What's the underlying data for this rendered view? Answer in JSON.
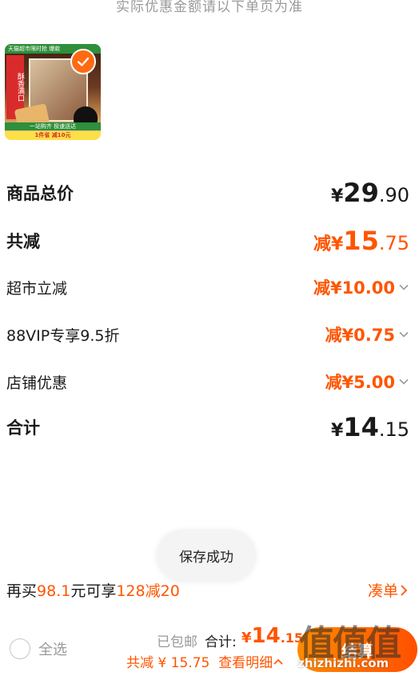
{
  "header": {
    "note": "实际优惠金额请以下单页为准"
  },
  "product": {
    "image_alt": "product-thumbnail",
    "image_top_text": "天猫超市限时抢 爆款",
    "image_side_text": "酥香满口",
    "image_band_text": "一站购齐 极速送达",
    "image_band2_text": "1件省 减10元"
  },
  "summary": {
    "total_price": {
      "label": "商品总价",
      "yen": "¥",
      "int": "29",
      "dec": ".90"
    },
    "total_discount": {
      "label": "共减",
      "prefix": "减",
      "yen": "¥",
      "int": "15",
      "dec": ".75"
    },
    "discounts": [
      {
        "label": "超市立减",
        "amount": "减¥10.00"
      },
      {
        "label": "88VIP专享9.5折",
        "amount": "减¥0.75"
      },
      {
        "label": "店铺优惠",
        "amount": "减¥5.00"
      }
    ],
    "subtotal": {
      "label": "合计",
      "yen": "¥",
      "int": "14",
      "dec": ".15"
    }
  },
  "toast": {
    "text": "保存成功"
  },
  "promo": {
    "pre": "再买",
    "amount": "98.1",
    "mid": "元可享",
    "offer": "128减20",
    "link": "凑单"
  },
  "footer": {
    "select_all": "全选",
    "shipping": "已包邮",
    "total_label": "合计:",
    "total_yen": "¥",
    "total_int": "14",
    "total_dec": ".15",
    "savings": "共减 ¥ 15.75",
    "details": "查看明细",
    "checkout": "结算"
  },
  "watermark": {
    "text": "值值值",
    "url": "zhizhizhi.com"
  },
  "colors": {
    "accent": "#ff5500",
    "checkout_start": "#ff8a00",
    "checkout_end": "#ff5000"
  }
}
